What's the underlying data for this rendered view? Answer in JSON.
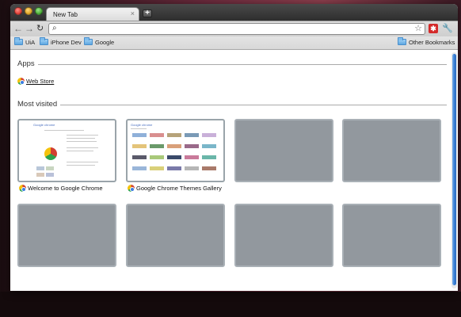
{
  "browser": {
    "tab_title": "New Tab",
    "tab_close": "×",
    "new_tab": "+",
    "address_value": "",
    "ext_label": "✱"
  },
  "bookmarks": {
    "items": [
      {
        "label": "UiA"
      },
      {
        "label": "iPhone Dev"
      },
      {
        "label": "Google"
      }
    ],
    "other": "Other Bookmarks"
  },
  "page": {
    "apps_title": "Apps",
    "webstore_label": "Web Store",
    "most_visited_title": "Most visited",
    "thumbnails": [
      {
        "label": "Welcome to Google Chrome"
      },
      {
        "label": "Google Chrome Themes Gallery"
      }
    ]
  },
  "colors": {
    "empty_thumb": "#92989e",
    "accent_blue": "#3a7fd5"
  }
}
